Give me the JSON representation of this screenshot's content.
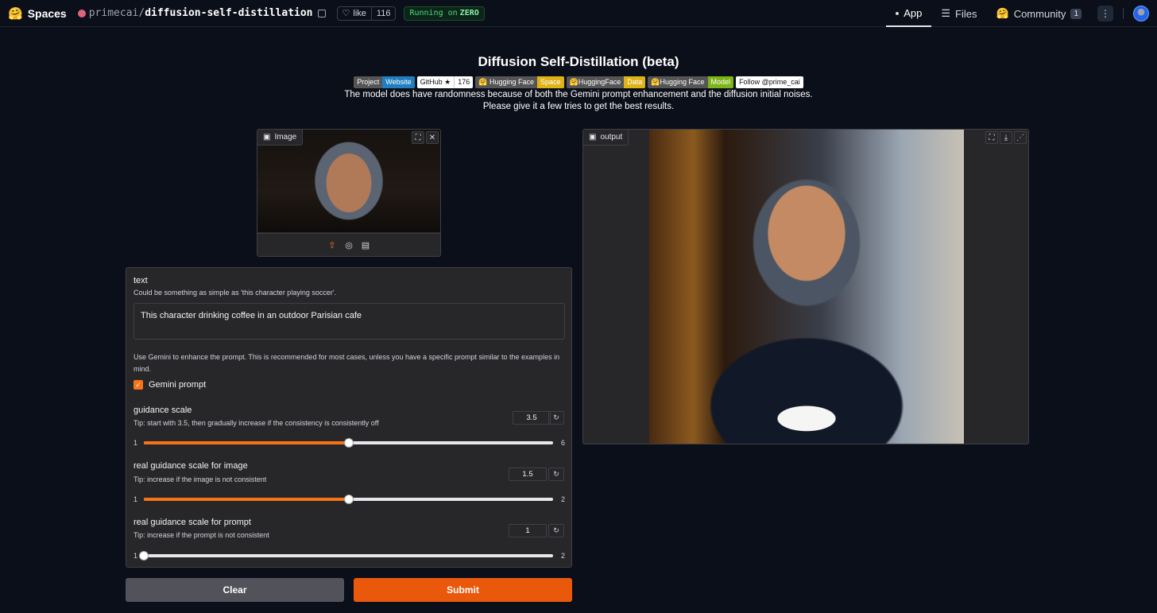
{
  "topbar": {
    "brand": "Spaces",
    "owner": "primecai",
    "repo": "diffusion-self-distillation",
    "like_label": "like",
    "like_count": "116",
    "running_label": "Running on",
    "running_hw": "ZERO",
    "tabs": [
      {
        "label": "App",
        "icon": "cube-icon"
      },
      {
        "label": "Files",
        "icon": "files-icon"
      },
      {
        "label": "Community",
        "icon": "community-icon",
        "badge": "1"
      }
    ]
  },
  "app": {
    "title": "Diffusion Self-Distillation (beta)",
    "badges": [
      {
        "left": "Project",
        "right": "Website"
      },
      {
        "left": "GitHub ★",
        "right": "176"
      },
      {
        "left": "🤗 Hugging Face",
        "right": "Space"
      },
      {
        "left": "🤗HuggingFace",
        "right": "Data"
      },
      {
        "left": "🤗Hugging Face",
        "right": "Model"
      },
      {
        "left": "Follow @prime_cai"
      }
    ],
    "subtitle_line1": "The model does have randomness because of both the Gemini prompt enhancement and the diffusion initial noises.",
    "subtitle_line2": "Please give it a few tries to get the best results."
  },
  "image_input": {
    "label": "Image"
  },
  "output": {
    "label": "output"
  },
  "controls": {
    "text_label": "text",
    "text_info": "Could be something as simple as 'this character playing soccer'.",
    "text_value": "This character drinking coffee in an outdoor Parisian cafe",
    "gemini_info": "Use Gemini to enhance the prompt. This is recommended for most cases, unless you have a specific prompt similar to the examples in mind.",
    "gemini_label": "Gemini prompt",
    "gemini_checked": true,
    "sliders": [
      {
        "label": "guidance scale",
        "info": "Tip: start with 3.5, then gradually increase if the consistency is consistently off",
        "value": "3.5",
        "min": "1",
        "max": "6",
        "fraction": 0.5
      },
      {
        "label": "real guidance scale for image",
        "info": "Tip: increase if the image is not consistent",
        "value": "1.5",
        "min": "1",
        "max": "2",
        "fraction": 0.5
      },
      {
        "label": "real guidance scale for prompt",
        "info": "Tip: increase if the prompt is not consistent",
        "value": "1",
        "min": "1",
        "max": "2",
        "fraction": 0.0
      }
    ]
  },
  "buttons": {
    "clear": "Clear",
    "submit": "Submit"
  }
}
